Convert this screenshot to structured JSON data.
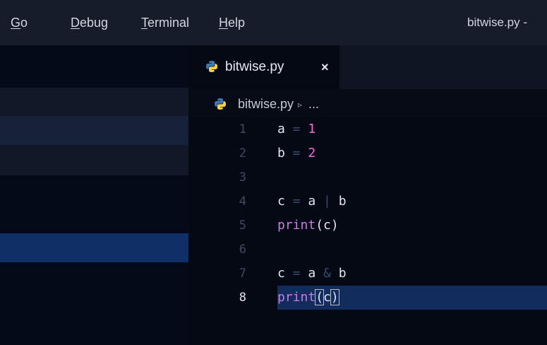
{
  "menu": [
    {
      "mnemonic": "G",
      "rest": "o"
    },
    {
      "mnemonic": "D",
      "rest": "ebug"
    },
    {
      "mnemonic": "T",
      "rest": "erminal"
    },
    {
      "mnemonic": "H",
      "rest": "elp"
    }
  ],
  "window_title": "bitwise.py -",
  "tab": {
    "label": "bitwise.py",
    "close": "×",
    "icon": "python-icon"
  },
  "breadcrumb": {
    "file": "bitwise.py",
    "separator": "▹",
    "more": "..."
  },
  "editor": {
    "active_line": 8,
    "lines": [
      {
        "num": "1",
        "tokens": [
          {
            "t": "a",
            "c": "var"
          },
          {
            "t": " = ",
            "c": "op"
          },
          {
            "t": "1",
            "c": "num"
          }
        ]
      },
      {
        "num": "2",
        "tokens": [
          {
            "t": "b",
            "c": "var"
          },
          {
            "t": " = ",
            "c": "op"
          },
          {
            "t": "2",
            "c": "num"
          }
        ]
      },
      {
        "num": "3",
        "tokens": []
      },
      {
        "num": "4",
        "tokens": [
          {
            "t": "c",
            "c": "var"
          },
          {
            "t": " = ",
            "c": "op"
          },
          {
            "t": "a",
            "c": "var"
          },
          {
            "t": " | ",
            "c": "op"
          },
          {
            "t": "b",
            "c": "var"
          }
        ]
      },
      {
        "num": "5",
        "tokens": [
          {
            "t": "print",
            "c": "fn"
          },
          {
            "t": "(c)",
            "c": "var"
          }
        ]
      },
      {
        "num": "6",
        "tokens": []
      },
      {
        "num": "7",
        "tokens": [
          {
            "t": "c",
            "c": "var"
          },
          {
            "t": " = ",
            "c": "op"
          },
          {
            "t": "a",
            "c": "var"
          },
          {
            "t": " & ",
            "c": "op"
          },
          {
            "t": "b",
            "c": "var"
          }
        ]
      },
      {
        "num": "8",
        "tokens": [
          {
            "t": "print",
            "c": "fn"
          },
          {
            "t": "(",
            "c": "bracket"
          },
          {
            "t": "c",
            "c": "var"
          },
          {
            "t": ")",
            "c": "bracket"
          }
        ]
      }
    ]
  },
  "colors": {
    "accent": "#122c5d",
    "number": "#ee6fd9",
    "function": "#c77be3",
    "python_blue": "#3c7ab4",
    "python_yellow": "#ffd43b"
  }
}
